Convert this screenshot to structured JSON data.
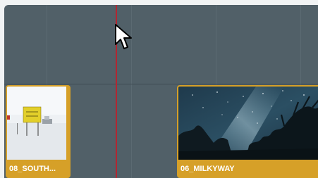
{
  "timeline": {
    "clips": [
      {
        "label": "08_SOUTH...",
        "thumbnail": "snowy-landscape-with-yellow-sign"
      },
      {
        "label": "06_MILKYWAY",
        "thumbnail": "night-sky-milky-way-over-trees"
      }
    ]
  },
  "colors": {
    "track_background": "#516068",
    "clip_border": "#d6a028",
    "playhead": "#b32631"
  },
  "icons": {
    "cursor": "arrow-cursor-icon"
  }
}
